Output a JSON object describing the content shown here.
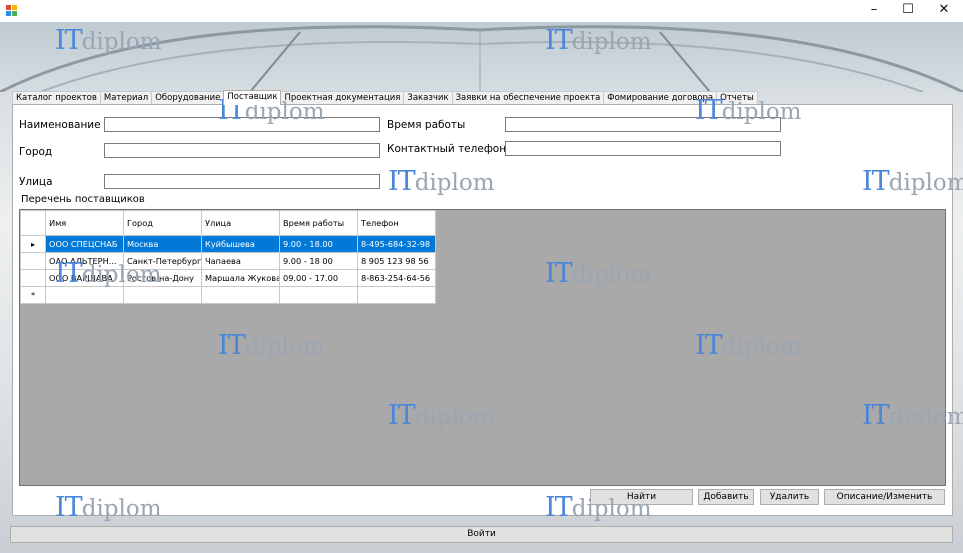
{
  "window": {
    "minimize": "–",
    "maximize": "☐",
    "close": "✕"
  },
  "tabs": [
    "Каталог проектов",
    "Материал",
    "Оборудование",
    "Поставщик",
    "Проектная документация",
    "Заказчик",
    "Заявки на обеспечение проекта",
    "Фомирование договора",
    "Отчеты"
  ],
  "form": {
    "name_label": "Наименование",
    "city_label": "Город",
    "street_label": "Улица",
    "hours_label": "Время работы",
    "phone_label": "Контактный телефон",
    "name_value": "",
    "city_value": "",
    "street_value": "",
    "hours_value": "",
    "phone_value": ""
  },
  "grid": {
    "title": "Перечень поставщиков",
    "columns": [
      "Имя",
      "Город",
      "Улица",
      "Время работы",
      "Телефон"
    ],
    "rows": [
      [
        "ООО СПЕЦСНАБ",
        "Москва",
        "Куйбышева",
        "9.00 - 18.00",
        "8-495-684-32-98"
      ],
      [
        "ОАО АЛЬТЕРН...",
        "Санкт-Петербург",
        "Чапаева",
        "9.00 - 18 00",
        "8 905 123 98 56"
      ],
      [
        "ООО ВАРШАВА",
        "Ростов-на-Дону",
        "Маршала Жукова",
        "09.00 - 17.00",
        "8-863-254-64-56"
      ]
    ],
    "selected_marker": "▸",
    "new_row_marker": "*"
  },
  "buttons": {
    "find": "Найти",
    "add": "Добавить",
    "delete": "Удалить",
    "edit": "Описание/Изменить",
    "exit": "Войти"
  },
  "watermark": {
    "it": "IT",
    "diplom": "diplom"
  }
}
